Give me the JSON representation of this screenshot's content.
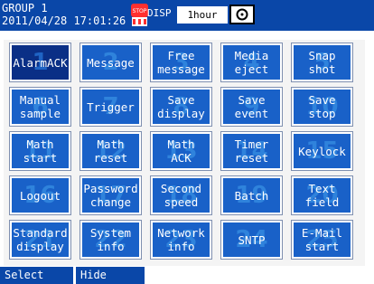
{
  "header": {
    "group": "GROUP 1",
    "datetime": "2011/04/28 17:01:26",
    "alarm_badge": "STOP",
    "disp": "DISP",
    "interval": "1hour"
  },
  "keys": [
    {
      "label": "AlarmACK",
      "num": "1"
    },
    {
      "label": "Message",
      "num": "2"
    },
    {
      "label": "Free\nmessage",
      "num": "3"
    },
    {
      "label": "Media\neject",
      "num": "4"
    },
    {
      "label": "Snap\nshot",
      "num": "5"
    },
    {
      "label": "Manual\nsample",
      "num": "6"
    },
    {
      "label": "Trigger",
      "num": "7"
    },
    {
      "label": "Save\ndisplay",
      "num": "8"
    },
    {
      "label": "Save\nevent",
      "num": "9"
    },
    {
      "label": "Save\nstop",
      "num": "10"
    },
    {
      "label": "Math\nstart",
      "num": "11"
    },
    {
      "label": "Math\nreset",
      "num": "12"
    },
    {
      "label": "Math\nACK",
      "num": "13"
    },
    {
      "label": "Timer\nreset",
      "num": "14"
    },
    {
      "label": "Keylock",
      "num": "15"
    },
    {
      "label": "Logout",
      "num": "16"
    },
    {
      "label": "Password\nchange",
      "num": "17"
    },
    {
      "label": "Second\nspeed",
      "num": "18"
    },
    {
      "label": "Batch",
      "num": "19"
    },
    {
      "label": "Text\nfield",
      "num": "20"
    },
    {
      "label": "Standard\ndisplay",
      "num": "21"
    },
    {
      "label": "System\ninfo",
      "num": "22"
    },
    {
      "label": "Network\ninfo",
      "num": "23"
    },
    {
      "label": "SNTP",
      "num": "24"
    },
    {
      "label": "E-Mail\nstart",
      "num": "25"
    }
  ],
  "softkeys": {
    "select": "Select",
    "hide": "Hide"
  },
  "colors": {
    "header_bg": "#0a47a8",
    "key_bg": "#1961c8",
    "key_selected_bg": "#0a2f86",
    "key_number": "#2f83dc"
  }
}
